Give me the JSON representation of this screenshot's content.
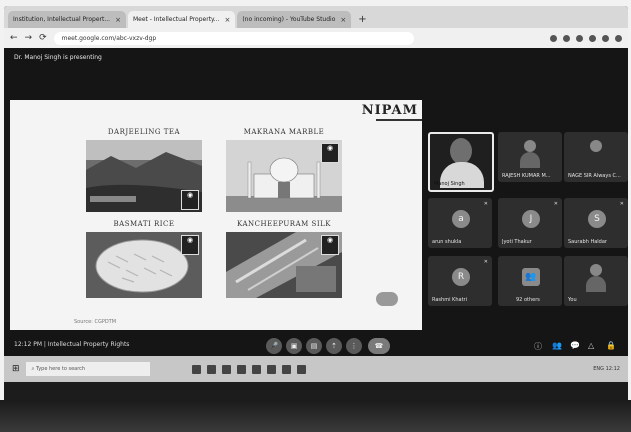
{
  "browser": {
    "tabs": [
      {
        "label": "Institution, Intellectual Propert..."
      },
      {
        "label": "Meet - Intellectual Property..."
      },
      {
        "label": "(no incoming) - YouTube Studio"
      }
    ],
    "url": "meet.google.com/abc-vxzv-dgp"
  },
  "meet": {
    "presenting_label": "Dr. Manoj Singh is presenting",
    "time": "12:12 PM",
    "meeting_title": "Intellectual Property Rights",
    "participants": [
      {
        "name": "Manoj Singh",
        "initial": ""
      },
      {
        "name": "RAJESH KUMAR M...",
        "initial": ""
      },
      {
        "name": "NAGE SIR Always C...",
        "initial": ""
      },
      {
        "name": "arun shukla",
        "initial": "a"
      },
      {
        "name": "Jyoti Thakur",
        "initial": "J"
      },
      {
        "name": "Saurabh Haldar",
        "initial": "S"
      },
      {
        "name": "Rashmi Khatri",
        "initial": "R"
      },
      {
        "name": "92 others",
        "initial": ""
      },
      {
        "name": "You",
        "initial": ""
      }
    ]
  },
  "slide": {
    "logo": "NIPAM",
    "panels": [
      {
        "caption": "DARJEELING TEA"
      },
      {
        "caption": "MAKRANA MARBLE"
      },
      {
        "caption": "BASMATI RICE"
      },
      {
        "caption": "KANCHEEPURAM SILK"
      }
    ],
    "footer_note": "Source: CGPDTM"
  },
  "taskbar": {
    "search_placeholder": "Type here to search",
    "tray_text": "ENG 12:12"
  }
}
